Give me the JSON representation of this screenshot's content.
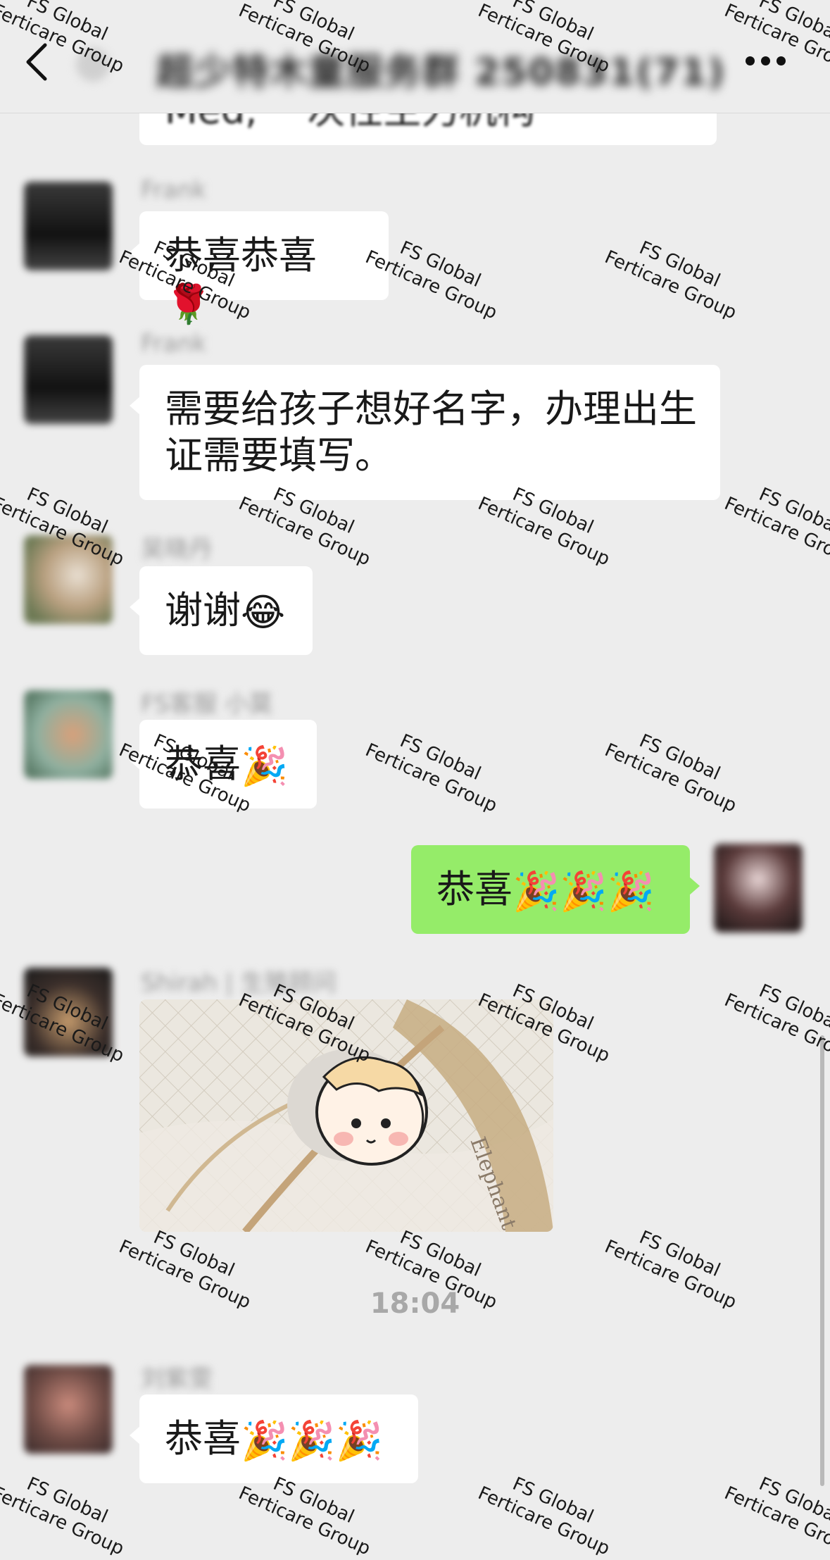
{
  "header": {
    "back_icon": "chevron-left-icon",
    "title": "超少特木童服务群 250831(71)",
    "more_icon": "ellipsis-icon"
  },
  "messages": [
    {
      "sender": "",
      "text": "Med, 一次性主力机构",
      "partial": true
    },
    {
      "sender": "Frank",
      "text": "恭喜恭喜",
      "emoji": "🌹"
    },
    {
      "sender": "Frank",
      "text": "需要给孩子想好名字，办理出生证需要填写。"
    },
    {
      "sender": "吴晓丹",
      "text": "谢谢",
      "emoji": "😂"
    },
    {
      "sender": "FS客服 小莫",
      "text": "恭喜",
      "emoji": "🎉"
    },
    {
      "sender": "me",
      "text": "恭喜",
      "emoji": "🎉🎉🎉"
    },
    {
      "sender": "Shirah | 生殖顾问",
      "type": "image",
      "caption": "Elephant"
    },
    {
      "sender": "刘紫雯",
      "text": "恭喜",
      "emoji": "🎉🎉🎉"
    }
  ],
  "timestamp": "18:04",
  "watermark": {
    "line1": "FS Global",
    "line2": "Ferticare Group"
  },
  "colors": {
    "background": "#ededed",
    "bubble_other": "#ffffff",
    "bubble_me": "#95ec69",
    "timestamp": "#a8a8a8"
  }
}
